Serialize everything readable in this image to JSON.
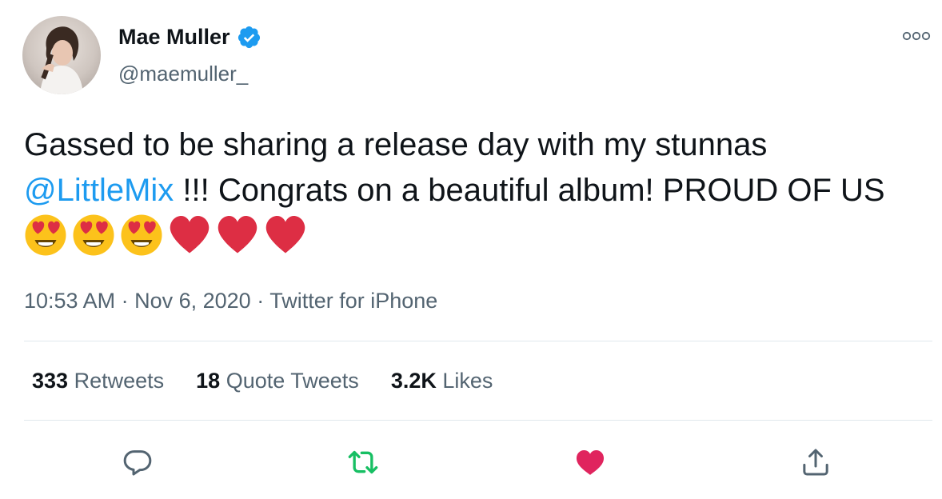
{
  "author": {
    "name": "Mae Muller",
    "handle": "@maemuller_",
    "verified": true
  },
  "tweet": {
    "text_part1": "Gassed to be sharing a release day with my stunnas",
    "mention": "@LittleMix",
    "text_part2": " !!! Congrats on a beautiful album! PROUD OF US",
    "emojis": [
      "heart-eyes-emoji",
      "heart-eyes-emoji",
      "heart-eyes-emoji",
      "red-heart-emoji",
      "red-heart-emoji",
      "red-heart-emoji"
    ]
  },
  "meta": {
    "time": "10:53 AM",
    "separator": " · ",
    "date": "Nov 6, 2020",
    "source": "Twitter for iPhone"
  },
  "stats": {
    "retweets": {
      "count": "333",
      "label": "Retweets"
    },
    "quotes": {
      "count": "18",
      "label": "Quote Tweets"
    },
    "likes": {
      "count": "3.2K",
      "label": "Likes"
    }
  },
  "actions": [
    "reply-icon",
    "retweet-icon",
    "like-icon",
    "share-icon"
  ],
  "colors": {
    "accent": "#1d9bf0",
    "retweet_active": "#17bf63",
    "like_active": "#e0245e",
    "secondary_text": "#536471",
    "divider": "#e1e8ed"
  }
}
